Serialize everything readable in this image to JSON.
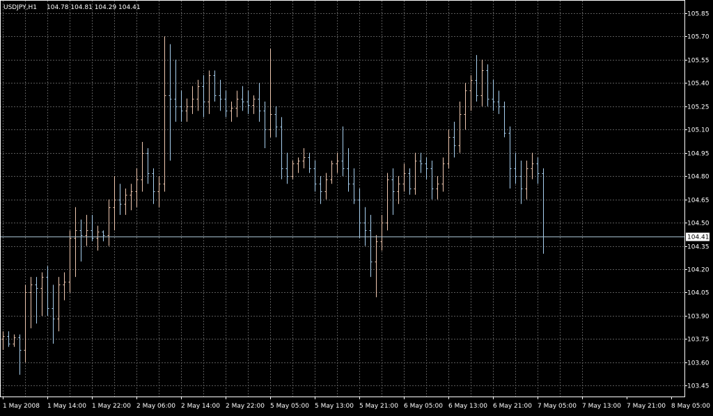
{
  "header": {
    "symbol": "USDJPY,H1",
    "ohlc_text": "104.78 104.81 104.29 104.41"
  },
  "colors": {
    "background": "#000000",
    "grid": "#5a5a5a",
    "frame": "#ffffff",
    "bull": "#f0c8b0",
    "bear": "#a8d0f0",
    "price_line": "#a8c0d0",
    "text": "#ffffff"
  },
  "chart_data": {
    "type": "ohlc",
    "title": "USDJPY,H1",
    "grid": true,
    "ylim": [
      103.38,
      105.93
    ],
    "y_ticks": [
      "105.85",
      "105.70",
      "105.55",
      "105.40",
      "105.25",
      "105.10",
      "104.95",
      "104.80",
      "104.65",
      "104.50",
      "104.35",
      "104.20",
      "104.05",
      "103.90",
      "103.75",
      "103.60",
      "103.45"
    ],
    "x_ticks": [
      "1 May 2008",
      "1 May 14:00",
      "1 May 22:00",
      "2 May 06:00",
      "2 May 14:00",
      "2 May 22:00",
      "5 May 05:00",
      "5 May 13:00",
      "5 May 21:00",
      "6 May 05:00",
      "6 May 13:00",
      "6 May 21:00",
      "7 May 05:00",
      "7 May 13:00",
      "7 May 21:00",
      "8 May 05:00"
    ],
    "bars_per_label": 8,
    "current_price": 104.41,
    "current_price_label": "104.41",
    "bars": [
      [
        103.75,
        103.8,
        103.68,
        103.77
      ],
      [
        103.77,
        103.8,
        103.7,
        103.72
      ],
      [
        103.72,
        103.78,
        103.7,
        103.76
      ],
      [
        103.76,
        103.78,
        103.52,
        103.68
      ],
      [
        103.68,
        104.1,
        103.6,
        104.05
      ],
      [
        104.05,
        104.15,
        103.82,
        104.1
      ],
      [
        104.1,
        104.15,
        103.85,
        104.08
      ],
      [
        104.08,
        104.18,
        103.9,
        104.15
      ],
      [
        104.15,
        104.22,
        103.9,
        103.95
      ],
      [
        103.95,
        104.1,
        103.72,
        103.88
      ],
      [
        103.88,
        104.15,
        103.8,
        104.1
      ],
      [
        104.1,
        104.18,
        104.0,
        104.12
      ],
      [
        104.12,
        104.45,
        104.05,
        104.4
      ],
      [
        104.4,
        104.6,
        104.15,
        104.45
      ],
      [
        104.45,
        104.52,
        104.25,
        104.42
      ],
      [
        104.42,
        104.55,
        104.35,
        104.45
      ],
      [
        104.45,
        104.55,
        104.38,
        104.4
      ],
      [
        104.4,
        104.48,
        104.32,
        104.44
      ],
      [
        104.44,
        104.45,
        104.38,
        104.42
      ],
      [
        104.42,
        104.65,
        104.35,
        104.6
      ],
      [
        104.6,
        104.8,
        104.45,
        104.65
      ],
      [
        104.65,
        104.75,
        104.55,
        104.62
      ],
      [
        104.62,
        104.72,
        104.55,
        104.68
      ],
      [
        104.68,
        104.75,
        104.58,
        104.7
      ],
      [
        104.7,
        104.85,
        104.6,
        104.78
      ],
      [
        104.78,
        105.02,
        104.7,
        104.95
      ],
      [
        104.95,
        104.98,
        104.75,
        104.82
      ],
      [
        104.82,
        104.85,
        104.62,
        104.7
      ],
      [
        104.7,
        104.8,
        104.6,
        104.75
      ],
      [
        104.75,
        105.7,
        104.7,
        105.32
      ],
      [
        105.32,
        105.65,
        104.9,
        105.3
      ],
      [
        105.3,
        105.55,
        105.15,
        105.25
      ],
      [
        105.25,
        105.35,
        105.15,
        105.22
      ],
      [
        105.22,
        105.3,
        105.15,
        105.25
      ],
      [
        105.25,
        105.38,
        105.2,
        105.3
      ],
      [
        105.3,
        105.42,
        105.22,
        105.38
      ],
      [
        105.38,
        105.45,
        105.18,
        105.28
      ],
      [
        105.28,
        105.48,
        105.2,
        105.45
      ],
      [
        105.45,
        105.48,
        105.28,
        105.32
      ],
      [
        105.32,
        105.42,
        105.22,
        105.3
      ],
      [
        105.3,
        105.35,
        105.18,
        105.22
      ],
      [
        105.22,
        105.28,
        105.15,
        105.24
      ],
      [
        105.24,
        105.35,
        105.18,
        105.3
      ],
      [
        105.3,
        105.38,
        105.22,
        105.28
      ],
      [
        105.28,
        105.35,
        105.2,
        105.26
      ],
      [
        105.26,
        105.32,
        105.2,
        105.3
      ],
      [
        105.3,
        105.4,
        105.15,
        105.22
      ],
      [
        105.22,
        105.28,
        104.98,
        105.1
      ],
      [
        105.1,
        105.62,
        105.05,
        105.2
      ],
      [
        105.2,
        105.25,
        105.05,
        105.12
      ],
      [
        105.12,
        105.18,
        104.78,
        104.85
      ],
      [
        104.85,
        104.95,
        104.75,
        104.8
      ],
      [
        104.8,
        104.9,
        104.78,
        104.88
      ],
      [
        104.88,
        104.92,
        104.82,
        104.9
      ],
      [
        104.9,
        104.98,
        104.85,
        104.92
      ],
      [
        104.92,
        104.95,
        104.82,
        104.85
      ],
      [
        104.85,
        104.9,
        104.7,
        104.75
      ],
      [
        104.75,
        104.8,
        104.62,
        104.7
      ],
      [
        104.7,
        104.82,
        104.65,
        104.78
      ],
      [
        104.78,
        104.9,
        104.75,
        104.88
      ],
      [
        104.88,
        104.95,
        104.82,
        104.9
      ],
      [
        104.9,
        105.12,
        104.8,
        104.85
      ],
      [
        104.85,
        104.98,
        104.7,
        104.75
      ],
      [
        104.75,
        104.85,
        104.62,
        104.65
      ],
      [
        104.65,
        104.72,
        104.4,
        104.5
      ],
      [
        104.5,
        104.6,
        104.35,
        104.45
      ],
      [
        104.45,
        104.55,
        104.15,
        104.25
      ],
      [
        104.25,
        104.42,
        104.02,
        104.38
      ],
      [
        104.38,
        104.55,
        104.32,
        104.5
      ],
      [
        104.5,
        104.82,
        104.45,
        104.78
      ],
      [
        104.78,
        104.85,
        104.55,
        104.7
      ],
      [
        104.7,
        104.8,
        104.62,
        104.75
      ],
      [
        104.75,
        104.88,
        104.7,
        104.82
      ],
      [
        104.82,
        104.85,
        104.68,
        104.72
      ],
      [
        104.72,
        104.95,
        104.68,
        104.9
      ],
      [
        104.9,
        104.95,
        104.82,
        104.88
      ],
      [
        104.88,
        104.92,
        104.78,
        104.85
      ],
      [
        104.85,
        104.9,
        104.65,
        104.72
      ],
      [
        104.72,
        104.8,
        104.65,
        104.75
      ],
      [
        104.75,
        104.92,
        104.7,
        104.88
      ],
      [
        104.88,
        105.1,
        104.85,
        105.05
      ],
      [
        105.05,
        105.15,
        104.92,
        105.0
      ],
      [
        105.0,
        105.28,
        104.95,
        105.2
      ],
      [
        105.2,
        105.4,
        105.1,
        105.35
      ],
      [
        105.35,
        105.45,
        105.22,
        105.42
      ],
      [
        105.42,
        105.58,
        105.28,
        105.32
      ],
      [
        105.32,
        105.55,
        105.25,
        105.48
      ],
      [
        105.48,
        105.52,
        105.25,
        105.3
      ],
      [
        105.3,
        105.42,
        105.22,
        105.28
      ],
      [
        105.28,
        105.35,
        105.2,
        105.25
      ],
      [
        105.25,
        105.28,
        105.05,
        105.08
      ],
      [
        105.08,
        105.12,
        104.72,
        104.85
      ],
      [
        104.85,
        104.95,
        104.75,
        104.8
      ],
      [
        104.8,
        104.9,
        104.62,
        104.72
      ],
      [
        104.72,
        104.9,
        104.65,
        104.85
      ],
      [
        104.85,
        104.95,
        104.78,
        104.88
      ],
      [
        104.88,
        104.92,
        104.75,
        104.82
      ],
      [
        104.82,
        104.85,
        104.3,
        104.41
      ]
    ]
  }
}
